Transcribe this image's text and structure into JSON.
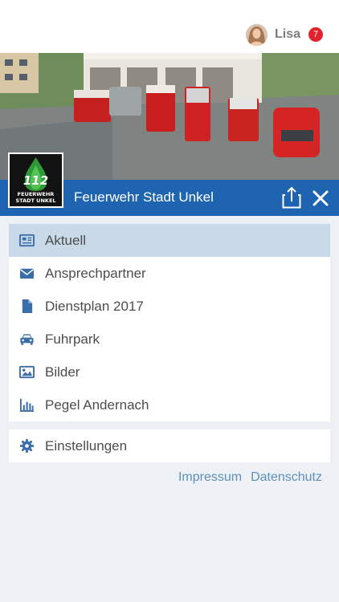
{
  "user": {
    "name": "Lisa",
    "notification_count": "7"
  },
  "organization": {
    "title": "Feuerwehr Stadt Unkel"
  },
  "logo": {
    "number": "112",
    "line1": "FEUERWEHR",
    "line2": "STADT UNKEL"
  },
  "menu": {
    "items": [
      {
        "label": "Aktuell",
        "icon": "newspaper-icon",
        "active": true
      },
      {
        "label": "Ansprechpartner",
        "icon": "envelope-icon",
        "active": false
      },
      {
        "label": "Dienstplan 2017",
        "icon": "document-icon",
        "active": false
      },
      {
        "label": "Fuhrpark",
        "icon": "car-icon",
        "active": false
      },
      {
        "label": "Bilder",
        "icon": "image-icon",
        "active": false
      },
      {
        "label": "Pegel Andernach",
        "icon": "bar-chart-icon",
        "active": false
      }
    ],
    "settings": {
      "label": "Einstellungen",
      "icon": "gear-icon"
    }
  },
  "footer": {
    "impressum": "Impressum",
    "datenschutz": "Datenschutz"
  },
  "colors": {
    "brand_blue": "#1e64b0",
    "active_row": "#cad9e8",
    "badge_red": "#e3232b",
    "icon_blue": "#3a6ea8",
    "link": "#5f8fba"
  }
}
